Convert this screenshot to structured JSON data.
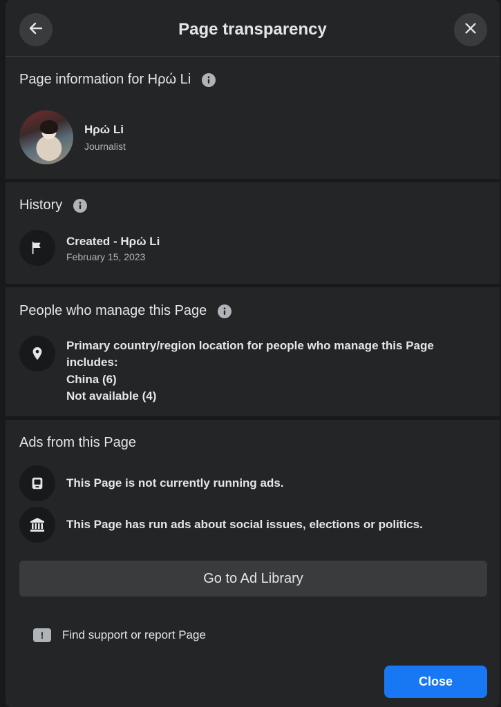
{
  "header": {
    "title": "Page transparency"
  },
  "page_info": {
    "heading": "Page information for Ηρώ Li",
    "name": "Ηρώ Li",
    "category": "Journalist"
  },
  "history": {
    "heading": "History",
    "event": "Created - Ηρώ Li",
    "date": "February 15, 2023"
  },
  "managers": {
    "heading": "People who manage this Page",
    "description": "Primary country/region location for people who manage this Page includes:",
    "locations": [
      "China (6)",
      "Not available (4)"
    ]
  },
  "ads": {
    "heading": "Ads from this Page",
    "not_running": "This Page is not currently running ads.",
    "political": "This Page has run ads about social issues, elections or politics.",
    "library_button": "Go to Ad Library"
  },
  "footer": {
    "support_label": "Find support or report Page",
    "close_label": "Close"
  },
  "colors": {
    "accent": "#1877f2",
    "surface": "#242526",
    "background": "#18191a"
  }
}
